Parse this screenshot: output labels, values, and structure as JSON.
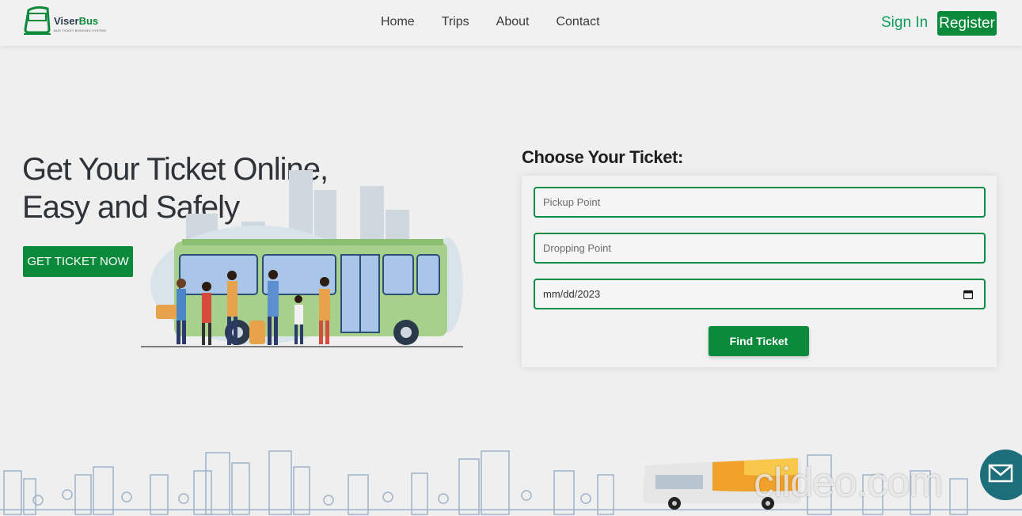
{
  "brand": {
    "name_part1": "Viser",
    "name_part2": "Bus",
    "tagline": "BUS TICKET BOOKING SYSTEM",
    "accent": "#0a8a3a"
  },
  "nav": {
    "items": [
      {
        "label": "Home"
      },
      {
        "label": "Trips"
      },
      {
        "label": "About"
      },
      {
        "label": "Contact"
      }
    ],
    "signin_label": "Sign In",
    "register_label": "Register"
  },
  "hero": {
    "title": "Get Your Ticket Online,\nEasy and Safely",
    "cta_label": "GET TICKET NOW"
  },
  "ticket_form": {
    "title": "Choose Your Ticket:",
    "pickup_placeholder": "Pickup Point",
    "dropping_placeholder": "Dropping Point",
    "date_value": "mm/dd/2023",
    "submit_label": "Find Ticket"
  },
  "watermark": {
    "text": "clideo.com"
  }
}
